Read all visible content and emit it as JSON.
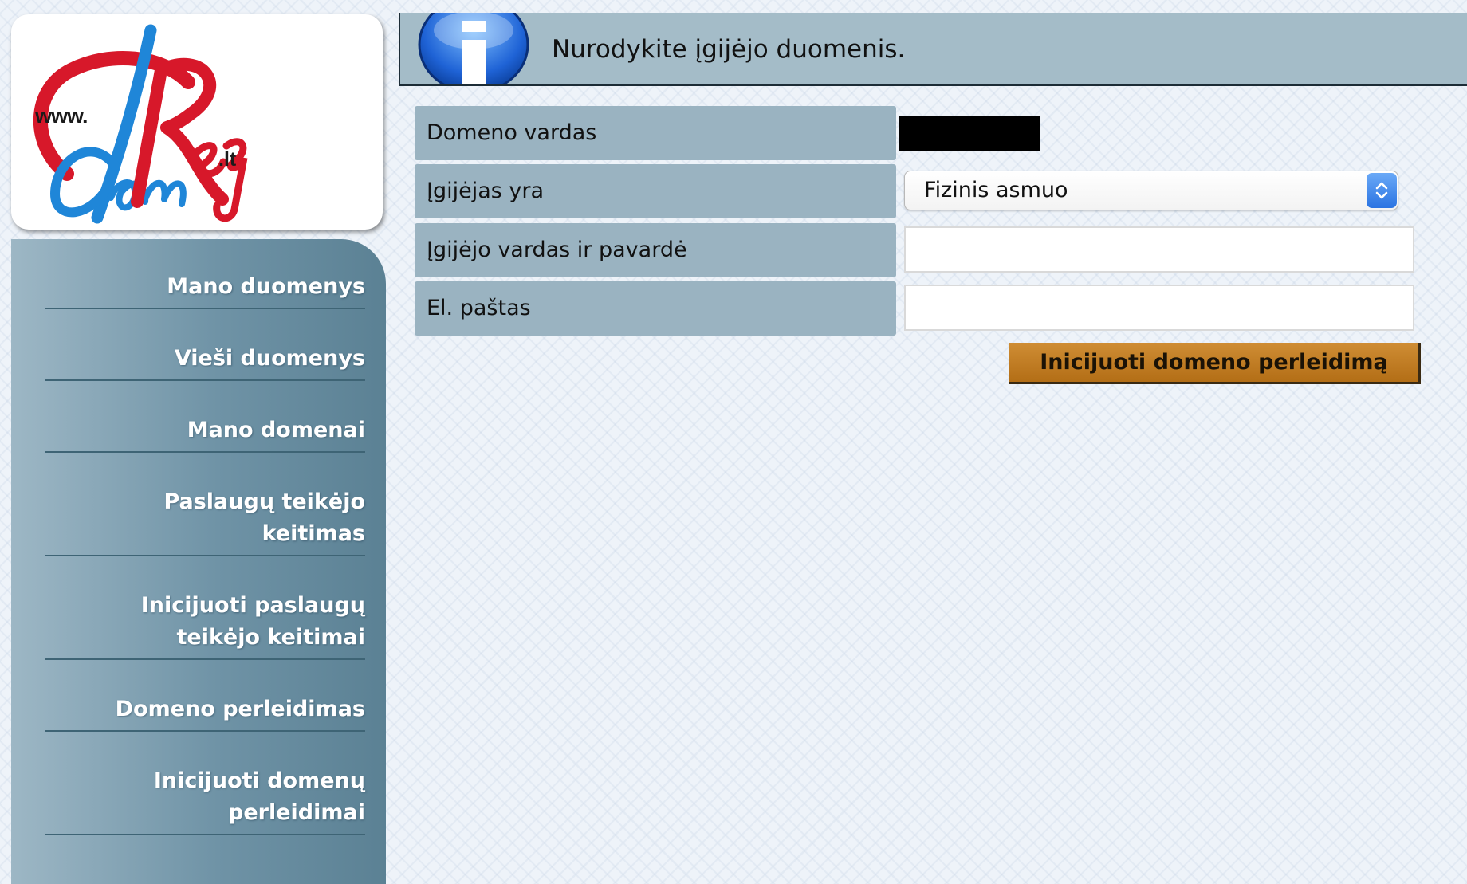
{
  "logo": {
    "www": "www.",
    "tld": ".lt"
  },
  "sidebar": {
    "items": [
      {
        "label": "Mano duomenys"
      },
      {
        "label": "Vieši duomenys"
      },
      {
        "label": "Mano domenai"
      },
      {
        "label": "Paslaugų teikėjo\nkeitimas"
      },
      {
        "label": "Inicijuoti paslaugų\nteikėjo keitimai"
      },
      {
        "label": "Domeno perleidimas"
      },
      {
        "label": "Inicijuoti domenų\nperleidimai"
      }
    ]
  },
  "info": {
    "icon": "info-icon",
    "message": "Nurodykite įgijėjo duomenis."
  },
  "form": {
    "domain_label": "Domeno vardas",
    "acquirer_type_label": "Įgijėjas yra",
    "acquirer_type_value": "Fizinis asmuo",
    "acquirer_name_label": "Įgijėjo vardas ir pavardė",
    "email_label": "El. paštas",
    "submit_label": "Inicijuoti domeno perleidimą"
  },
  "colors": {
    "sidebar": "#6f93a6",
    "form_label_bg": "#9ab3c1",
    "header_bg": "#a4bcc8",
    "button": "#c27d26",
    "logo_red": "#d7182a",
    "logo_blue": "#1f86d8"
  }
}
